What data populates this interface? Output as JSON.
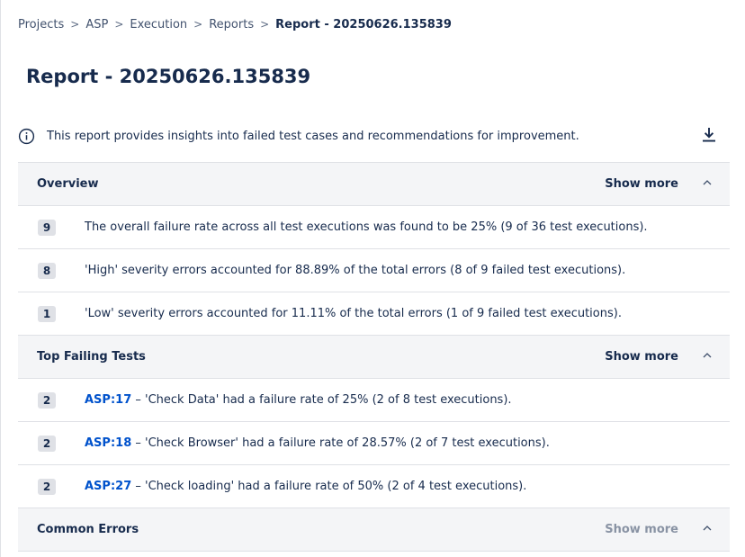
{
  "breadcrumb": {
    "items": [
      "Projects",
      "ASP",
      "Execution",
      "Reports"
    ],
    "current": "Report - 20250626.135839",
    "separator": ">"
  },
  "page_title": "Report - 20250626.135839",
  "info": {
    "icon": "info-circle-icon",
    "text": "This report provides insights into failed test cases and recommendations for improvement.",
    "download_icon": "download-icon"
  },
  "sections": {
    "overview": {
      "title": "Overview",
      "show_more": "Show more",
      "items": [
        {
          "count": "9",
          "text": "The overall failure rate across all test executions was found to be 25% (9 of 36 test executions)."
        },
        {
          "count": "8",
          "text": "'High' severity errors accounted for 88.89% of the total errors (8 of 9 failed test executions)."
        },
        {
          "count": "1",
          "text": "'Low' severity errors accounted for 11.11% of the total errors (1 of 9 failed test executions)."
        }
      ]
    },
    "top_failing": {
      "title": "Top Failing Tests",
      "show_more": "Show more",
      "items": [
        {
          "count": "2",
          "key": "ASP:17",
          "text": " – 'Check Data' had a failure rate of 25% (2 of 8 test executions)."
        },
        {
          "count": "2",
          "key": "ASP:18",
          "text": " – 'Check Browser' had a failure rate of 28.57% (2 of 7 test executions)."
        },
        {
          "count": "2",
          "key": "ASP:27",
          "text": " – 'Check loading' had a failure rate of 50% (2 of 4 test executions)."
        }
      ]
    },
    "common_errors": {
      "title": "Common Errors",
      "show_more": "Show more"
    }
  },
  "colors": {
    "link": "#0052cc",
    "section_bg": "#f4f5f7",
    "badge_bg": "#dfe1e6",
    "border": "#dfe1e6",
    "muted_text": "#8993a4"
  }
}
